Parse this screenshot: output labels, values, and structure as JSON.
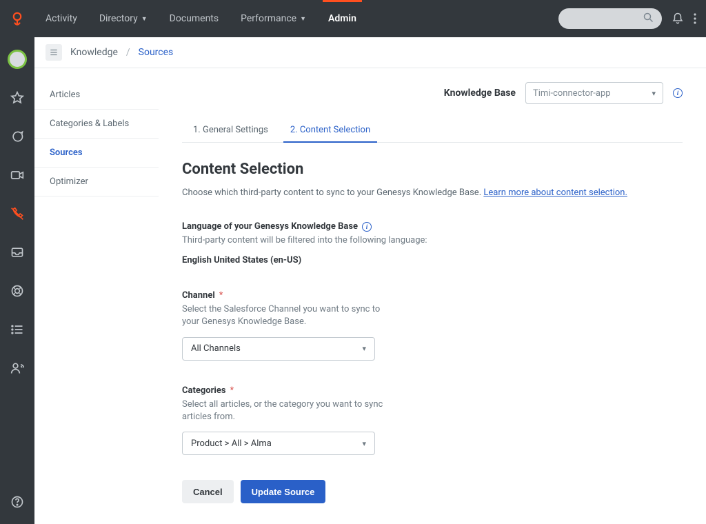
{
  "topnav": {
    "items": [
      {
        "label": "Activity",
        "dropdown": false,
        "active": false
      },
      {
        "label": "Directory",
        "dropdown": true,
        "active": false
      },
      {
        "label": "Documents",
        "dropdown": false,
        "active": false
      },
      {
        "label": "Performance",
        "dropdown": true,
        "active": false
      },
      {
        "label": "Admin",
        "dropdown": false,
        "active": true
      }
    ]
  },
  "breadcrumb": {
    "root": "Knowledge",
    "current": "Sources"
  },
  "innernav": {
    "items": [
      {
        "label": "Articles",
        "active": false
      },
      {
        "label": "Categories & Labels",
        "active": false
      },
      {
        "label": "Sources",
        "active": true
      },
      {
        "label": "Optimizer",
        "active": false
      }
    ]
  },
  "kb": {
    "label": "Knowledge Base",
    "selected": "Timi-connector-app"
  },
  "tabs": [
    {
      "label": "1. General Settings",
      "active": false
    },
    {
      "label": "2. Content Selection",
      "active": true
    }
  ],
  "page": {
    "title": "Content Selection",
    "description_pre": "Choose which third-party content to sync to your Genesys Knowledge Base. ",
    "description_link": "Learn more about content selection."
  },
  "language": {
    "label": "Language of your Genesys Knowledge Base",
    "help": "Third-party content will be filtered into the following language:",
    "value": "English United States (en-US)"
  },
  "channel": {
    "label": "Channel",
    "help": "Select the Salesforce Channel you want to sync to your Genesys Knowledge Base.",
    "selected": "All Channels"
  },
  "categories": {
    "label": "Categories",
    "help": "Select all articles, or the category you want to sync articles from.",
    "selected": "Product > All > Alma"
  },
  "buttons": {
    "cancel": "Cancel",
    "submit": "Update Source"
  }
}
